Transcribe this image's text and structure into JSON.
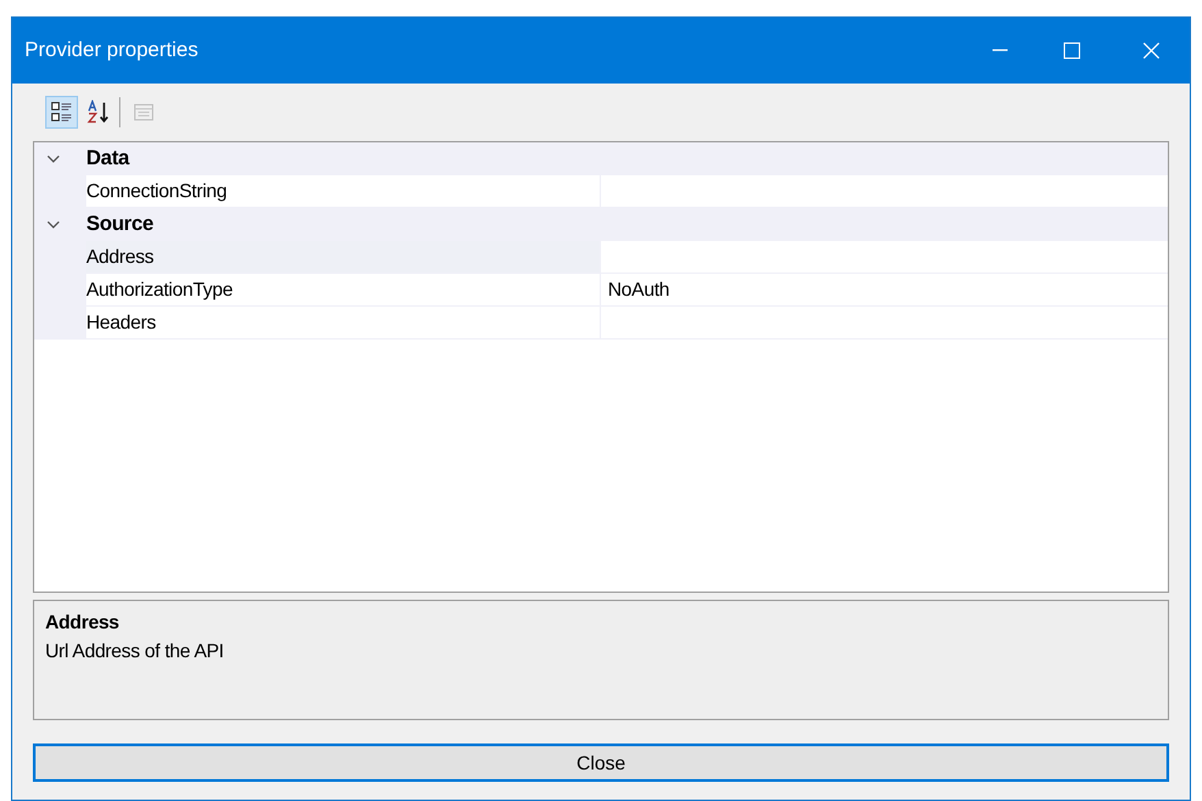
{
  "window": {
    "title": "Provider properties"
  },
  "toolbar": [
    {
      "kind": "categorized",
      "selected": true,
      "disabled": false
    },
    {
      "kind": "alphabetical",
      "selected": false,
      "disabled": false
    },
    {
      "kind": "pages",
      "selected": false,
      "disabled": true
    }
  ],
  "grid": {
    "categories": [
      {
        "name": "Data",
        "expanded": true,
        "properties": [
          {
            "name": "ConnectionString",
            "selected": false
          }
        ]
      },
      {
        "name": "Source",
        "expanded": true,
        "properties": [
          {
            "name": "Address",
            "selected": true
          },
          {
            "name": "AuthorizationType",
            "value": "NoAuth",
            "selected": false
          },
          {
            "name": "Headers",
            "selected": false
          }
        ]
      }
    ]
  },
  "description": {
    "title": "Address",
    "text": "Url Address of the API"
  },
  "close_button": "Close"
}
